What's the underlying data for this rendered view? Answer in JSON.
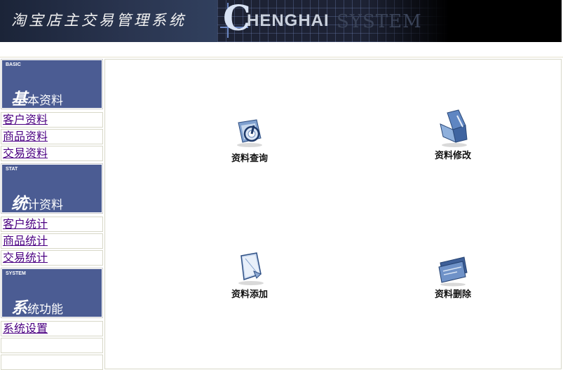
{
  "banner": {
    "title": "淘宝店主交易管理系统",
    "logo_c": "C",
    "logo_rest": "HENGHAI",
    "logo_system": "SYSTEM"
  },
  "sidebar": {
    "sections": [
      {
        "en": "BASIC",
        "cn_big": "基",
        "cn_small": "本资料",
        "items": [
          "客户资料",
          "商品资料",
          "交易资料"
        ]
      },
      {
        "en": "STAT",
        "cn_big": "统",
        "cn_small": "计资料",
        "items": [
          "客户统计",
          "商品统计",
          "交易统计"
        ]
      },
      {
        "en": "SYSTEM",
        "cn_big": "系",
        "cn_small": "统功能",
        "items": [
          "系统设置"
        ]
      }
    ]
  },
  "actions": {
    "query": "资料查询",
    "modify": "资料修改",
    "add": "资料添加",
    "delete": "资料删除"
  },
  "colors": {
    "section_header_bg": "#4b5c93",
    "link": "#4b0082",
    "banner_bg": "#000000"
  }
}
